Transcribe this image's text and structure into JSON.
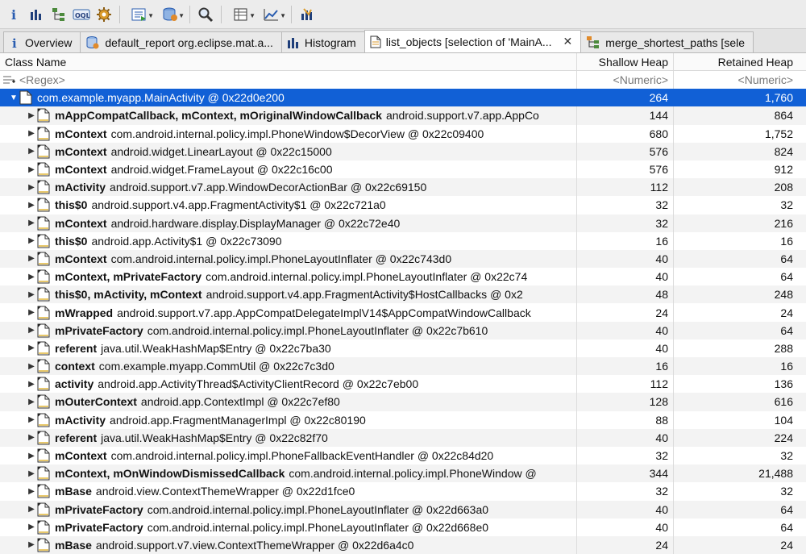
{
  "toolbar": {
    "buttons": [
      "info-icon",
      "histogram-icon",
      "dominator-tree-icon",
      "oql-icon",
      "heap-dump-overview-icon",
      "run-expert-icon",
      "query-browser-icon",
      "find-object-icon",
      "group-by-icon",
      "calculate-retained-icon",
      "pin-icon"
    ]
  },
  "tabs": [
    {
      "label": "Overview",
      "icon": "info-icon"
    },
    {
      "label": "default_report  org.eclipse.mat.a...",
      "icon": "report-icon"
    },
    {
      "label": "Histogram",
      "icon": "histogram-icon"
    },
    {
      "label": "list_objects [selection of 'MainA...",
      "icon": "list-objects-icon",
      "active": true,
      "closable": true
    },
    {
      "label": "merge_shortest_paths [sele",
      "icon": "merge-paths-icon"
    }
  ],
  "columns": {
    "name": "Class Name",
    "shallow": "Shallow Heap",
    "retained": "Retained Heap"
  },
  "filter": {
    "name": "<Regex>",
    "shallow": "<Numeric>",
    "retained": "<Numeric>"
  },
  "root": {
    "name": "com.example.myapp.MainActivity @ 0x22d0e200",
    "shallow": "264",
    "retained": "1,760"
  },
  "rows": [
    {
      "field": "mAppCompatCallback, mContext, mOriginalWindowCallback",
      "cls": "android.support.v7.app.AppCo",
      "shallow": "144",
      "retained": "864"
    },
    {
      "field": "mContext",
      "cls": "com.android.internal.policy.impl.PhoneWindow$DecorView @ 0x22c09400",
      "shallow": "680",
      "retained": "1,752"
    },
    {
      "field": "mContext",
      "cls": "android.widget.LinearLayout @ 0x22c15000",
      "shallow": "576",
      "retained": "824"
    },
    {
      "field": "mContext",
      "cls": "android.widget.FrameLayout @ 0x22c16c00",
      "shallow": "576",
      "retained": "912"
    },
    {
      "field": "mActivity",
      "cls": "android.support.v7.app.WindowDecorActionBar @ 0x22c69150",
      "shallow": "112",
      "retained": "208"
    },
    {
      "field": "this$0",
      "cls": "android.support.v4.app.FragmentActivity$1 @ 0x22c721a0",
      "shallow": "32",
      "retained": "32"
    },
    {
      "field": "mContext",
      "cls": "android.hardware.display.DisplayManager @ 0x22c72e40",
      "shallow": "32",
      "retained": "216"
    },
    {
      "field": "this$0",
      "cls": "android.app.Activity$1 @ 0x22c73090",
      "shallow": "16",
      "retained": "16"
    },
    {
      "field": "mContext",
      "cls": "com.android.internal.policy.impl.PhoneLayoutInflater @ 0x22c743d0",
      "shallow": "40",
      "retained": "64"
    },
    {
      "field": "mContext, mPrivateFactory",
      "cls": "com.android.internal.policy.impl.PhoneLayoutInflater @ 0x22c74",
      "shallow": "40",
      "retained": "64"
    },
    {
      "field": "this$0, mActivity, mContext",
      "cls": "android.support.v4.app.FragmentActivity$HostCallbacks @ 0x2",
      "shallow": "48",
      "retained": "248"
    },
    {
      "field": "mWrapped",
      "cls": "android.support.v7.app.AppCompatDelegateImplV14$AppCompatWindowCallback",
      "shallow": "24",
      "retained": "24"
    },
    {
      "field": "mPrivateFactory",
      "cls": "com.android.internal.policy.impl.PhoneLayoutInflater @ 0x22c7b610",
      "shallow": "40",
      "retained": "64"
    },
    {
      "field": "referent",
      "cls": "java.util.WeakHashMap$Entry @ 0x22c7ba30",
      "shallow": "40",
      "retained": "288"
    },
    {
      "field": "context",
      "cls": "com.example.myapp.CommUtil @ 0x22c7c3d0",
      "shallow": "16",
      "retained": "16"
    },
    {
      "field": "activity",
      "cls": "android.app.ActivityThread$ActivityClientRecord @ 0x22c7eb00",
      "shallow": "112",
      "retained": "136"
    },
    {
      "field": "mOuterContext",
      "cls": "android.app.ContextImpl @ 0x22c7ef80",
      "shallow": "128",
      "retained": "616"
    },
    {
      "field": "mActivity",
      "cls": "android.app.FragmentManagerImpl @ 0x22c80190",
      "shallow": "88",
      "retained": "104"
    },
    {
      "field": "referent",
      "cls": "java.util.WeakHashMap$Entry @ 0x22c82f70",
      "shallow": "40",
      "retained": "224"
    },
    {
      "field": "mContext",
      "cls": "com.android.internal.policy.impl.PhoneFallbackEventHandler @ 0x22c84d20",
      "shallow": "32",
      "retained": "32"
    },
    {
      "field": "mContext, mOnWindowDismissedCallback",
      "cls": "com.android.internal.policy.impl.PhoneWindow @",
      "shallow": "344",
      "retained": "21,488"
    },
    {
      "field": "mBase",
      "cls": "android.view.ContextThemeWrapper @ 0x22d1fce0",
      "shallow": "32",
      "retained": "32"
    },
    {
      "field": "mPrivateFactory",
      "cls": "com.android.internal.policy.impl.PhoneLayoutInflater @ 0x22d663a0",
      "shallow": "40",
      "retained": "64"
    },
    {
      "field": "mPrivateFactory",
      "cls": "com.android.internal.policy.impl.PhoneLayoutInflater @ 0x22d668e0",
      "shallow": "40",
      "retained": "64"
    },
    {
      "field": "mBase",
      "cls": "android.support.v7.view.ContextThemeWrapper @ 0x22d6a4c0",
      "shallow": "24",
      "retained": "24"
    }
  ],
  "colors": {
    "selection": "#1160d6",
    "altRow": "#f3f3f3",
    "objectIcon": "#e8c86a"
  }
}
